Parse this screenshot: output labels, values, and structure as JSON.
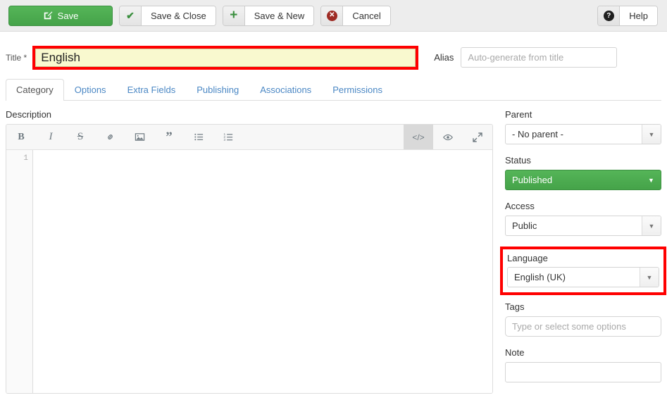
{
  "toolbar": {
    "save_label": "Save",
    "save_close_label": "Save & Close",
    "save_new_label": "Save & New",
    "cancel_label": "Cancel",
    "help_label": "Help",
    "icons": {
      "save": "edit-square-icon",
      "save_close": "check-icon",
      "save_new": "plus-icon",
      "cancel": "x-circle-icon",
      "help": "question-circle-icon"
    },
    "colors": {
      "save_green": "#4CAF50",
      "cancel_red": "#9E2B24",
      "help_dark": "#1F1F1F"
    }
  },
  "title_field": {
    "label": "Title *",
    "value": "English",
    "highlight_color": "#FF0000",
    "background_color": "#F9F9CF"
  },
  "alias_field": {
    "label": "Alias",
    "value": "",
    "placeholder": "Auto-generate from title"
  },
  "tabs": [
    {
      "label": "Category",
      "active": true
    },
    {
      "label": "Options",
      "active": false
    },
    {
      "label": "Extra Fields",
      "active": false
    },
    {
      "label": "Publishing",
      "active": false
    },
    {
      "label": "Associations",
      "active": false
    },
    {
      "label": "Permissions",
      "active": false
    }
  ],
  "description": {
    "label": "Description",
    "line_number": "1",
    "content": "",
    "toolbar_buttons": [
      {
        "name": "bold-icon",
        "glyph": "B"
      },
      {
        "name": "italic-icon",
        "glyph": "I"
      },
      {
        "name": "strikethrough-icon",
        "glyph": "S"
      },
      {
        "name": "link-icon",
        "glyph": "&#128279;"
      },
      {
        "name": "image-icon",
        "glyph": "&#128443;"
      },
      {
        "name": "quote-icon",
        "glyph": "&#8221;"
      },
      {
        "name": "unordered-list-icon",
        "glyph": "&#8801;"
      },
      {
        "name": "ordered-list-icon",
        "glyph": "&#8803;"
      }
    ],
    "right_buttons": [
      {
        "name": "source-code-icon",
        "glyph": "</>",
        "active": true
      },
      {
        "name": "preview-eye-icon",
        "glyph": "&#128065;",
        "active": false
      },
      {
        "name": "fullscreen-icon",
        "glyph": "&#10696;",
        "active": false
      }
    ]
  },
  "sidebar": {
    "parent": {
      "label": "Parent",
      "value": "- No parent -"
    },
    "status": {
      "label": "Status",
      "value": "Published",
      "color": "#4CAF50"
    },
    "access": {
      "label": "Access",
      "value": "Public"
    },
    "language": {
      "label": "Language",
      "value": "English (UK)",
      "highlighted": true,
      "highlight_color": "#FF0000"
    },
    "tags": {
      "label": "Tags",
      "value": "",
      "placeholder": "Type or select some options"
    },
    "note": {
      "label": "Note",
      "value": "",
      "placeholder": ""
    }
  }
}
